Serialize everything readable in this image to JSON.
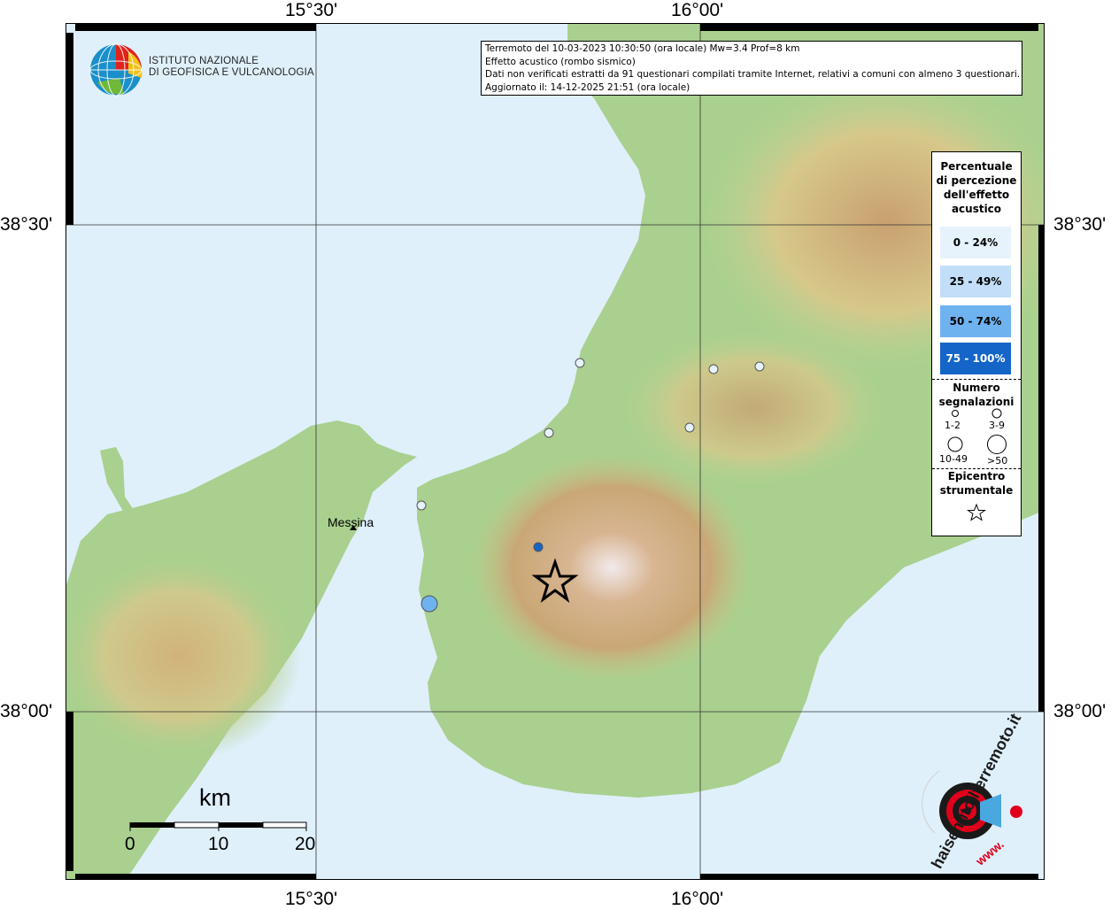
{
  "axes": {
    "top_lon": [
      "15°30'",
      "16°00'"
    ],
    "bottom_lon": [
      "15°30'",
      "16°00'"
    ],
    "left_lat": [
      "38°30'",
      "38°00'"
    ],
    "right_lat": [
      "38°30'",
      "38°00'"
    ]
  },
  "institute": {
    "name_line1": "ISTITUTO NAZIONALE",
    "name_line2": "DI GEOFISICA E VULCANOLOGIA"
  },
  "info": {
    "line1": "Terremoto del 10-03-2023 10:30:50 (ora locale) Mw=3.4 Prof=8 km",
    "line2": "Effetto acustico (rombo sismico)",
    "line3": "Dati non verificati estratti da 91 questionari compilati tramite Internet, relativi a comuni con almeno 3 questionari.",
    "line4": "Aggiornato il: 14-12-2025 21:51 (ora locale)"
  },
  "legend": {
    "title_line1": "Percentuale",
    "title_line2": "di percezione",
    "title_line3": "dell'effetto",
    "title_line4": "acustico",
    "classes": [
      {
        "label": "0 - 24%",
        "color": "#e6f3fd"
      },
      {
        "label": "25 - 49%",
        "color": "#c2def8"
      },
      {
        "label": "50 - 74%",
        "color": "#6eb2f0"
      },
      {
        "label": "75 - 100%",
        "color": "#1565c8"
      }
    ],
    "count_title_line1": "Numero",
    "count_title_line2": "segnalazioni",
    "counts": [
      "1-2",
      "3-9",
      "10-49",
      ">50"
    ],
    "epicenter_line1": "Epicentro",
    "epicenter_line2": "strumentale"
  },
  "place": "Messina",
  "scale": {
    "unit": "km",
    "ticks": [
      "0",
      "10",
      "20"
    ]
  },
  "brand": {
    "text": "haisentitoilterremoto.it",
    "www": "www."
  },
  "colors": {
    "sea": "#dff0fb",
    "land_low": "#a5cf8c",
    "land_mid": "#d9cc8c",
    "land_high": "#c09a68",
    "peak": "#f0e8e8"
  }
}
